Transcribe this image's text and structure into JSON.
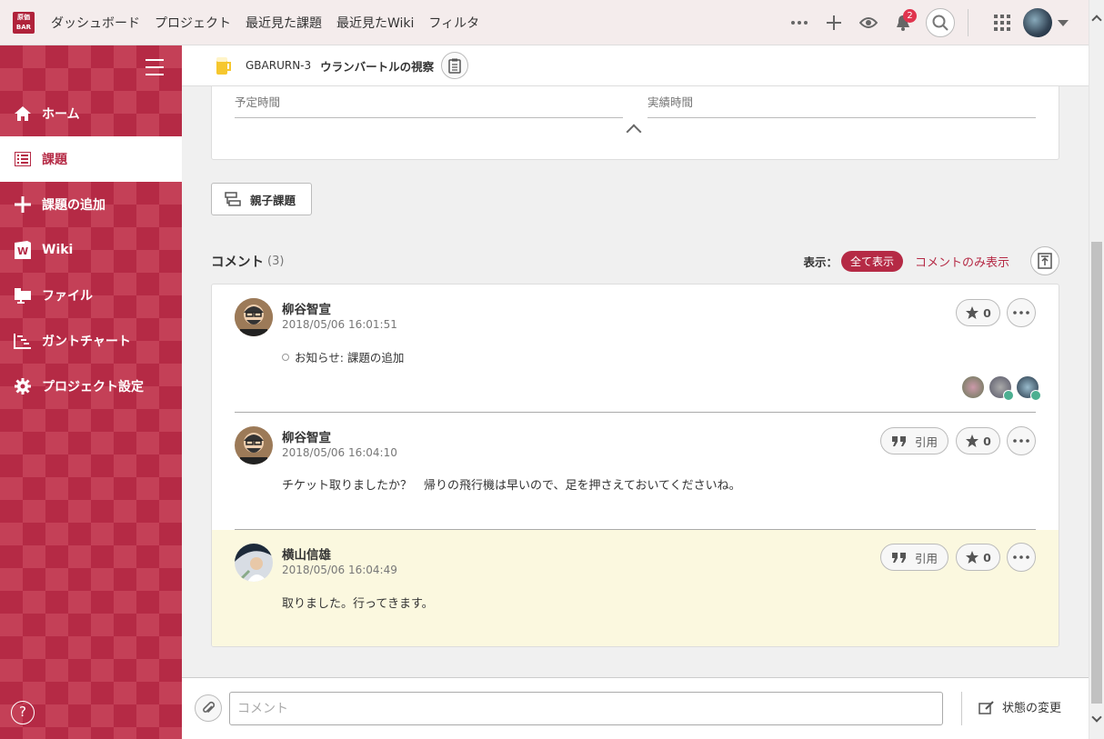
{
  "topnav": {
    "logo_text": "原価BAR",
    "links": [
      "ダッシュボード",
      "プロジェクト",
      "最近見た課題",
      "最近見たWiki",
      "フィルタ"
    ],
    "notification_count": "2"
  },
  "sidebar": {
    "items": [
      {
        "label": "ホーム",
        "icon": "home-icon"
      },
      {
        "label": "課題",
        "icon": "list-icon"
      },
      {
        "label": "課題の追加",
        "icon": "plus-icon"
      },
      {
        "label": "Wiki",
        "icon": "wiki-icon"
      },
      {
        "label": "ファイル",
        "icon": "folder-icon"
      },
      {
        "label": "ガントチャート",
        "icon": "gantt-icon"
      },
      {
        "label": "プロジェクト設定",
        "icon": "gear-icon"
      }
    ],
    "active_index": 1,
    "help": "?"
  },
  "header": {
    "issue_key": "GBARURN-3",
    "issue_title": "ウランバートルの視察"
  },
  "details": {
    "planned_time_label": "予定時間",
    "actual_time_label": "実績時間"
  },
  "parent_button": "親子課題",
  "comments": {
    "title": "コメント",
    "count": "(3)",
    "show_label": "表示：",
    "show_all": "全て表示",
    "show_comments_only": "コメントのみ表示",
    "quote_label": "引用",
    "items": [
      {
        "author": "柳谷智宣",
        "date": "2018/05/06 16:01:51",
        "notice": "お知らせ: 課題の追加",
        "stars": "0"
      },
      {
        "author": "柳谷智宣",
        "date": "2018/05/06 16:04:10",
        "body": "チケット取りましたか？　帰りの飛行機は早いので、足を押さえておいてくださいね。",
        "stars": "0"
      },
      {
        "author": "横山信雄",
        "date": "2018/05/06 16:04:49",
        "body": "取りました。行ってきます。",
        "stars": "0"
      }
    ]
  },
  "bottom": {
    "comment_placeholder": "コメント",
    "status_change": "状態の変更"
  },
  "colors": {
    "brand": "#b52a45",
    "highlight": "#fbf8df"
  }
}
